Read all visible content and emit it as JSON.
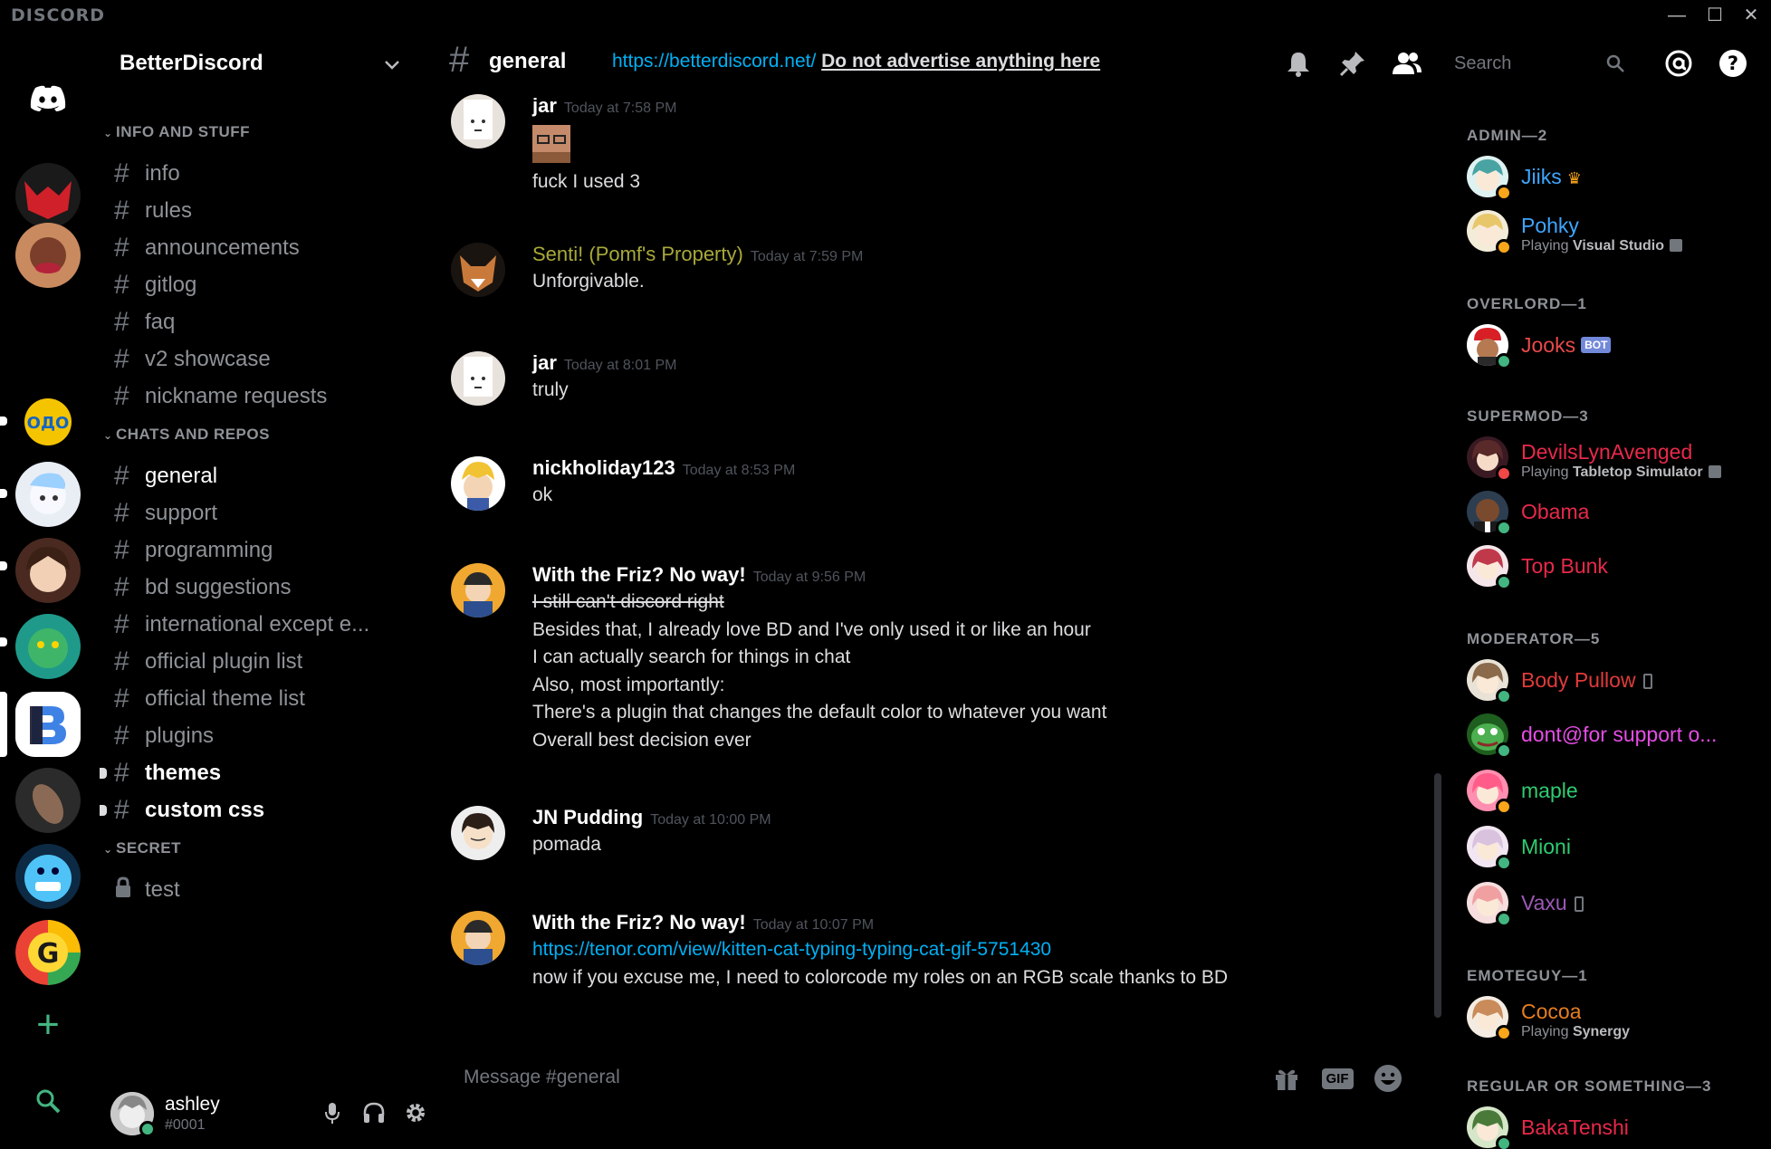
{
  "window": {
    "brand": "DISCORD",
    "minimize": "—",
    "maximize": "☐",
    "close": "✕"
  },
  "colors": {
    "online": "#43b581",
    "idle": "#faa61a",
    "dnd": "#f04747",
    "link": "#00b0f4"
  },
  "guilds": [
    "BetterDiscord",
    "server-2",
    "server-3",
    "server-4",
    "server-5",
    "server-6",
    "server-7",
    "server-8",
    "server-9",
    "server-10"
  ],
  "server": {
    "name": "BetterDiscord"
  },
  "categories": {
    "info": "INFO AND STUFF",
    "chats": "CHATS AND REPOS",
    "secret": "SECRET"
  },
  "channels": {
    "info": [
      "info",
      "rules",
      "announcements",
      "gitlog",
      "faq",
      "v2 showcase",
      "nickname requests"
    ],
    "chats": [
      "general",
      "support",
      "programming",
      "bd suggestions",
      "international except e...",
      "official plugin list",
      "official theme list",
      "plugins",
      "themes",
      "custom css"
    ],
    "secret": [
      "test"
    ]
  },
  "user": {
    "name": "ashley",
    "discriminator": "#0001"
  },
  "header": {
    "channel": "general",
    "topic_link": "https://betterdiscord.net/",
    "topic_text": "Do not advertise anything here",
    "search_placeholder": "Search"
  },
  "messages": [
    {
      "author": "jar",
      "time": "Today at 7:58 PM",
      "lines": [
        "fuck I used 3"
      ]
    },
    {
      "author": "Senti! (Pomf's Property)",
      "time": "Today at 7:59 PM",
      "lines": [
        "Unforgivable."
      ]
    },
    {
      "author": "jar",
      "time": "Today at 8:01 PM",
      "lines": [
        "truly"
      ]
    },
    {
      "author": "nickholiday123",
      "time": "Today at 8:53 PM",
      "lines": [
        "ok"
      ]
    },
    {
      "author": "With the Friz? No way!",
      "time": "Today at 9:56 PM",
      "lines": [
        "I still can't discord right",
        "Besides that, I already love BD and I've only used it or like an hour",
        "I can actually search for things in chat",
        "Also, most importantly:",
        "There's a plugin that changes the default color to whatever you want",
        "Overall best decision ever"
      ]
    },
    {
      "author": "JN Pudding",
      "time": "Today at 10:00 PM",
      "lines": [
        "pomada"
      ]
    },
    {
      "author": "With the Friz? No way!",
      "time": "Today at 10:07 PM",
      "lines": [
        "https://tenor.com/view/kitten-cat-typing-typing-cat-gif-5751430",
        "now if you excuse me, I need to colorcode my roles on an RGB scale thanks to BD"
      ]
    }
  ],
  "composer": {
    "placeholder": "Message #general",
    "gif": "GIF"
  },
  "roles": [
    {
      "name": "ADMIN—2"
    },
    {
      "name": "OVERLORD—1"
    },
    {
      "name": "SUPERMOD—3"
    },
    {
      "name": "MODERATOR—5"
    },
    {
      "name": "EMOTEGUY—1"
    },
    {
      "name": "REGULAR OR SOMETHING—3"
    }
  ],
  "members": [
    {
      "name": "Jiiks",
      "color": "#3ea6ff",
      "status": "idle"
    },
    {
      "name": "Pohky",
      "color": "#3ea6ff",
      "status": "idle",
      "activity_prefix": "Playing",
      "activity": "Visual Studio"
    },
    {
      "name": "Jooks",
      "color": "#e84a4a",
      "status": "online",
      "tag": "BOT"
    },
    {
      "name": "DevilsLynAvenged",
      "color": "#e8294a",
      "status": "dnd",
      "activity_prefix": "Playing",
      "activity": "Tabletop Simulator"
    },
    {
      "name": "Obama",
      "color": "#e8294a",
      "status": "online"
    },
    {
      "name": "Top Bunk",
      "color": "#e8294a",
      "status": "online"
    },
    {
      "name": "Body Pullow",
      "color": "#e03a3a",
      "status": "online"
    },
    {
      "name": "dont@for support o...",
      "color": "#e64de6",
      "status": "online"
    },
    {
      "name": "maple",
      "color": "#2ecc71",
      "status": "idle"
    },
    {
      "name": "Mioni",
      "color": "#2ecc71",
      "status": "online"
    },
    {
      "name": "Vaxu",
      "color": "#9b59b6",
      "status": "online"
    },
    {
      "name": "Cocoa",
      "color": "#e67e22",
      "status": "idle",
      "activity_prefix": "Playing",
      "activity": "Synergy"
    },
    {
      "name": "BakaTenshi",
      "color": "#e8294a",
      "status": "online"
    }
  ]
}
